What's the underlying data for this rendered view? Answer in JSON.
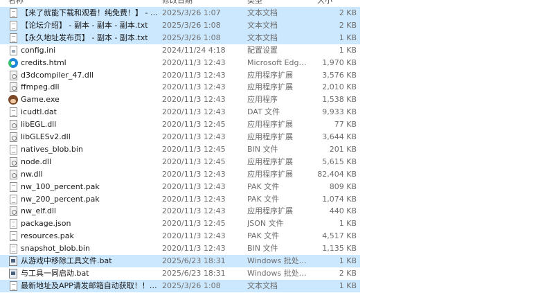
{
  "columns": {
    "name": "名称",
    "date": "修改日期",
    "type": "类型",
    "size": "大小"
  },
  "files": [
    {
      "name": "【来了就能下载和观看！纯免费！】 - 副...",
      "date": "2025/3/26 1:07",
      "type": "文本文档",
      "size": "2 KB",
      "icon": "text-file-icon",
      "selected": true
    },
    {
      "name": "【论坛介绍】 - 副本 - 副本 - 副本.txt",
      "date": "2025/3/26 1:08",
      "type": "文本文档",
      "size": "2 KB",
      "icon": "text-file-icon",
      "selected": true
    },
    {
      "name": "【永久地址发布页】 - 副本 - 副本.txt",
      "date": "2025/3/26 1:08",
      "type": "文本文档",
      "size": "1 KB",
      "icon": "text-file-icon",
      "selected": true
    },
    {
      "name": "config.ini",
      "date": "2024/11/24 4:18",
      "type": "配置设置",
      "size": "1 KB",
      "icon": "config-file-icon",
      "selected": false
    },
    {
      "name": "credits.html",
      "date": "2020/11/3 12:43",
      "type": "Microsoft Edge ...",
      "size": "1,970 KB",
      "icon": "edge-icon",
      "selected": false
    },
    {
      "name": "d3dcompiler_47.dll",
      "date": "2020/11/3 12:43",
      "type": "应用程序扩展",
      "size": "3,576 KB",
      "icon": "dll-file-icon",
      "selected": false
    },
    {
      "name": "ffmpeg.dll",
      "date": "2020/11/3 12:43",
      "type": "应用程序扩展",
      "size": "2,010 KB",
      "icon": "dll-file-icon",
      "selected": false
    },
    {
      "name": "Game.exe",
      "date": "2020/11/3 12:43",
      "type": "应用程序",
      "size": "1,538 KB",
      "icon": "game-app-icon",
      "selected": false
    },
    {
      "name": "icudtl.dat",
      "date": "2020/11/3 12:43",
      "type": "DAT 文件",
      "size": "9,933 KB",
      "icon": "blank-file-icon",
      "selected": false
    },
    {
      "name": "libEGL.dll",
      "date": "2020/11/3 12:45",
      "type": "应用程序扩展",
      "size": "77 KB",
      "icon": "dll-file-icon",
      "selected": false
    },
    {
      "name": "libGLESv2.dll",
      "date": "2020/11/3 12:43",
      "type": "应用程序扩展",
      "size": "3,644 KB",
      "icon": "dll-file-icon",
      "selected": false
    },
    {
      "name": "natives_blob.bin",
      "date": "2020/11/3 12:45",
      "type": "BIN 文件",
      "size": "201 KB",
      "icon": "blank-file-icon",
      "selected": false
    },
    {
      "name": "node.dll",
      "date": "2020/11/3 12:45",
      "type": "应用程序扩展",
      "size": "5,615 KB",
      "icon": "dll-file-icon",
      "selected": false
    },
    {
      "name": "nw.dll",
      "date": "2020/11/3 12:43",
      "type": "应用程序扩展",
      "size": "82,404 KB",
      "icon": "dll-file-icon",
      "selected": false
    },
    {
      "name": "nw_100_percent.pak",
      "date": "2020/11/3 12:43",
      "type": "PAK 文件",
      "size": "809 KB",
      "icon": "blank-file-icon",
      "selected": false
    },
    {
      "name": "nw_200_percent.pak",
      "date": "2020/11/3 12:43",
      "type": "PAK 文件",
      "size": "1,074 KB",
      "icon": "blank-file-icon",
      "selected": false
    },
    {
      "name": "nw_elf.dll",
      "date": "2020/11/3 12:43",
      "type": "应用程序扩展",
      "size": "440 KB",
      "icon": "dll-file-icon",
      "selected": false
    },
    {
      "name": "package.json",
      "date": "2020/11/3 12:45",
      "type": "JSON 文件",
      "size": "1 KB",
      "icon": "blank-file-icon",
      "selected": false
    },
    {
      "name": "resources.pak",
      "date": "2020/11/3 12:43",
      "type": "PAK 文件",
      "size": "4,517 KB",
      "icon": "blank-file-icon",
      "selected": false
    },
    {
      "name": "snapshot_blob.bin",
      "date": "2020/11/3 12:43",
      "type": "BIN 文件",
      "size": "1,135 KB",
      "icon": "blank-file-icon",
      "selected": false
    },
    {
      "name": "从游戏中移除工具文件.bat",
      "date": "2025/6/23 18:31",
      "type": "Windows 批处理...",
      "size": "1 KB",
      "icon": "batch-file-icon",
      "selected": true
    },
    {
      "name": "与工具一同启动.bat",
      "date": "2025/6/23 18:31",
      "type": "Windows 批处理...",
      "size": "2 KB",
      "icon": "batch-file-icon",
      "selected": false
    },
    {
      "name": "最新地址及APP请发邮箱自动获取！！！...",
      "date": "2025/3/26 1:08",
      "type": "文本文档",
      "size": "1 KB",
      "icon": "text-file-icon",
      "selected": true
    }
  ]
}
